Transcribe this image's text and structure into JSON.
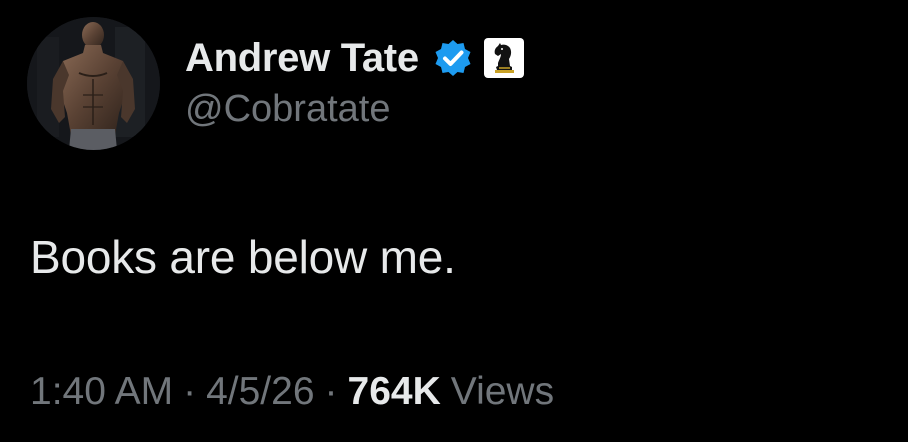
{
  "author": {
    "display_name": "Andrew Tate",
    "handle": "@Cobratate",
    "verified": true,
    "verified_icon": "verified-check-icon",
    "affiliate_badge_icon": "chess-knight-icon",
    "avatar": "profile-photo"
  },
  "tweet": {
    "text": "Books are below me."
  },
  "meta": {
    "time": "1:40 AM",
    "separator": "·",
    "date": "4/5/26",
    "views_count": "764K",
    "views_label": "Views"
  },
  "colors": {
    "background": "#000000",
    "primary_text": "#e7e9ea",
    "secondary_text": "#71767b",
    "verified_blue": "#1d9bf0"
  }
}
